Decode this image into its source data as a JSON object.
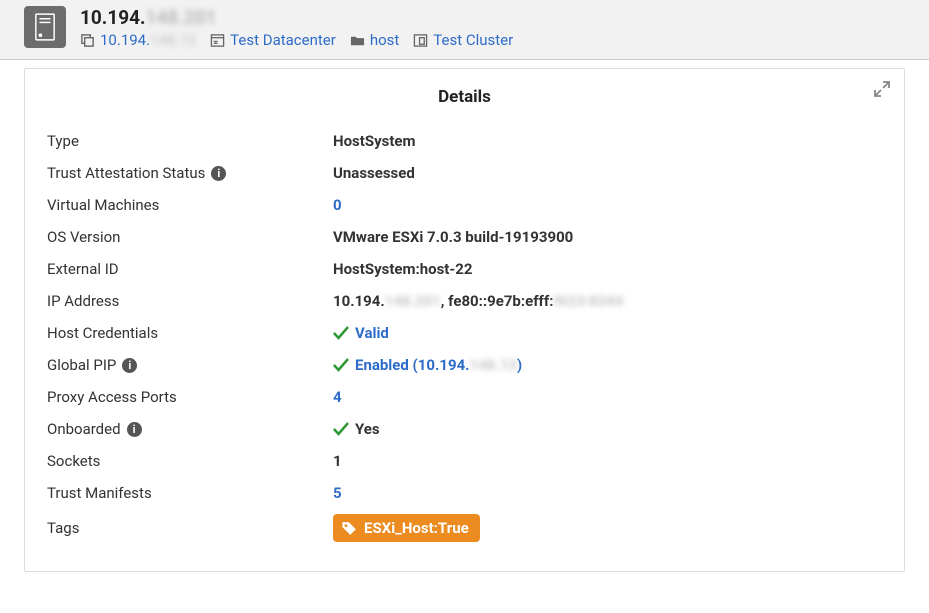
{
  "header": {
    "title_prefix": "10.194.",
    "title_obscured": "148.201",
    "breadcrumb": {
      "host_prefix": "10.194.",
      "host_obscured": "148.12",
      "datacenter": "Test Datacenter",
      "folder": "host",
      "cluster": "Test Cluster"
    }
  },
  "panel": {
    "title": "Details"
  },
  "details": {
    "type": {
      "label": "Type",
      "value": "HostSystem"
    },
    "trust": {
      "label": "Trust Attestation Status",
      "value": "Unassessed"
    },
    "vms": {
      "label": "Virtual Machines",
      "value": "0"
    },
    "os": {
      "label": "OS Version",
      "value": "VMware ESXi 7.0.3 build-19193900"
    },
    "extid": {
      "label": "External ID",
      "value": "HostSystem:host-22"
    },
    "ip": {
      "label": "IP Address",
      "prefix1": "10.194.",
      "ob1": "148.201",
      "prefix2": ", fe80::9e7b:efff:",
      "ob2": "f623:8344"
    },
    "creds": {
      "label": "Host Credentials",
      "value": "Valid"
    },
    "pip": {
      "label": "Global PIP",
      "prefix": "Enabled (10.194.",
      "ob": "148.13",
      "suffix": ")"
    },
    "ports": {
      "label": "Proxy Access Ports",
      "value": "4"
    },
    "onboard": {
      "label": "Onboarded",
      "value": "Yes"
    },
    "sockets": {
      "label": "Sockets",
      "value": "1"
    },
    "manifests": {
      "label": "Trust Manifests",
      "value": "5"
    },
    "tags": {
      "label": "Tags",
      "value": "ESXi_Host:True"
    }
  }
}
